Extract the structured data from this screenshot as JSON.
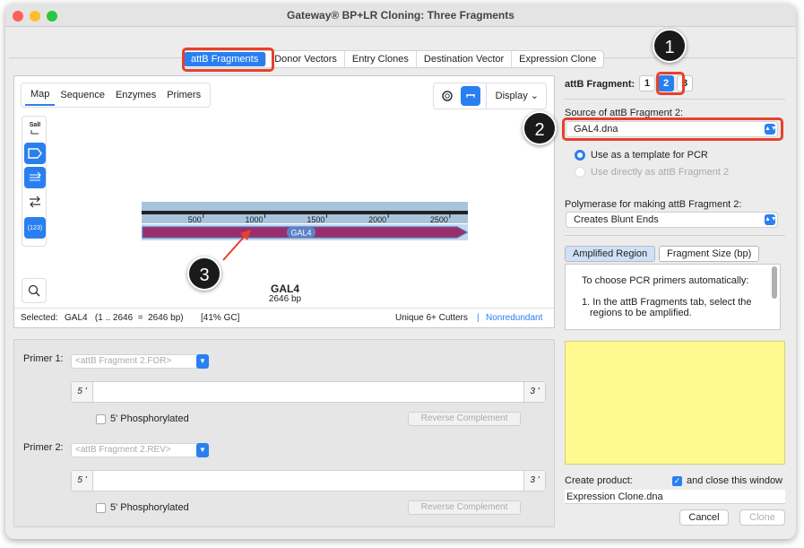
{
  "window": {
    "title": "Gateway® BP+LR Cloning: Three Fragments"
  },
  "tabs": [
    "attB Fragments",
    "Donor Vectors",
    "Entry Clones",
    "Destination Vector",
    "Expression Clone"
  ],
  "map_panel": {
    "view_tabs": [
      "Map",
      "Sequence",
      "Enzymes",
      "Primers"
    ],
    "display_label": "Display",
    "tool_sall_label": "SalI",
    "tool_numbers_label": "(123)",
    "sequence": {
      "name": "GAL4",
      "length": "2646 bp",
      "feature_label": "GAL4"
    },
    "ruler_ticks": [
      "500",
      "1000",
      "1500",
      "2000",
      "2500"
    ],
    "status": {
      "selected_label": "Selected:",
      "selected_value": "GAL4   (1 .. 2646  =  2646 bp)",
      "gc": "[41% GC]",
      "cutters": "Unique 6+ Cutters",
      "separator": "|",
      "nonredundant": "Nonredundant"
    }
  },
  "primers": {
    "primer1_label": "Primer 1:",
    "primer1_value": "<attB Fragment 2.FOR>",
    "primer2_label": "Primer 2:",
    "primer2_value": "<attB Fragment 2.REV>",
    "end5": "5 '",
    "end3": "3 '",
    "phosphorylated_label": "5' Phosphorylated",
    "reverse_complement_label": "Reverse Complement"
  },
  "right": {
    "fragment_label": "attB Fragment:",
    "fragment_options": [
      "1",
      "2",
      "3"
    ],
    "source_label": "Source of attB Fragment 2:",
    "source_value": "GAL4.dna",
    "radio_template": "Use as a template for PCR",
    "radio_direct": "Use directly as attB Fragment 2",
    "polymerase_label": "Polymerase for making attB Fragment 2:",
    "polymerase_value": "Creates Blunt Ends",
    "seg_tabs": [
      "Amplified Region",
      "Fragment Size (bp)"
    ],
    "info_line1": "To choose PCR primers automatically:",
    "info_line2": "1. In the attB Fragments tab, select the",
    "info_line3": "regions to be amplified.",
    "create_label": "Create product:",
    "close_label": "and close this window",
    "product_name": "Expression Clone.dna",
    "cancel_label": "Cancel",
    "clone_label": "Clone"
  },
  "callouts": [
    "1",
    "2",
    "3"
  ],
  "colors": {
    "accent": "#2a7ff0",
    "highlight": "#e8402c",
    "feature": "#9b2d6b",
    "yellow": "#fff98f"
  }
}
